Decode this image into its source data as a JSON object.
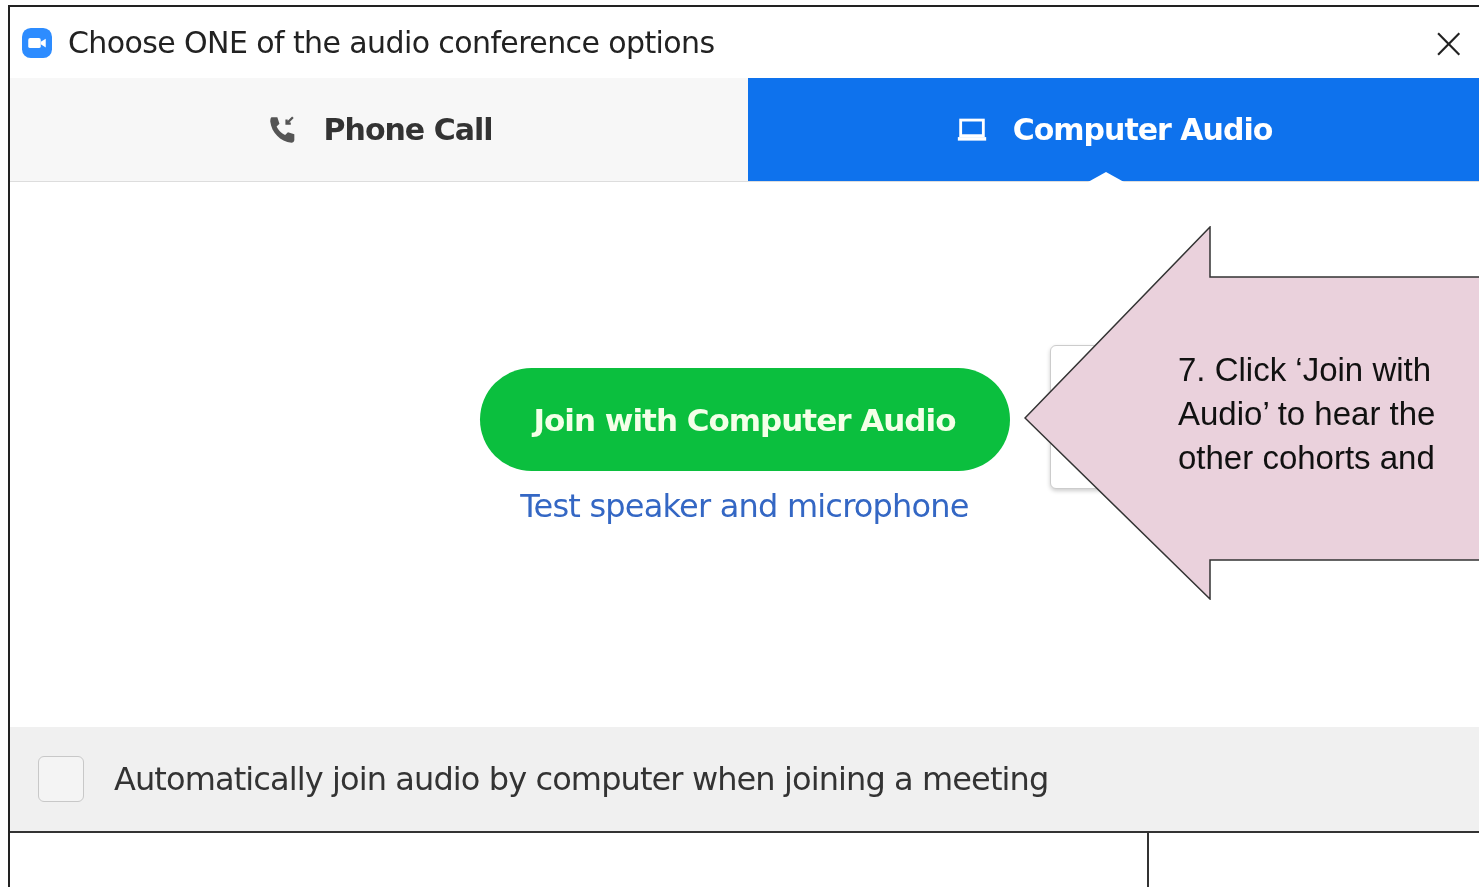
{
  "window": {
    "title": "Choose ONE of the audio conference options",
    "close": "×"
  },
  "tabs": [
    {
      "label": "Phone Call",
      "kind": "phone",
      "selected": false
    },
    {
      "label": "Computer Audio",
      "kind": "computer",
      "selected": true
    }
  ],
  "join_button": "Join with Computer Audio",
  "test_link": "Test speaker and microphone",
  "auto_join": {
    "label": "Automatically join audio by computer when joining a meeting",
    "checked": false
  },
  "callout": {
    "lines": [
      "7. Click ‘Join with",
      "Audio’ to hear the",
      "other cohorts and"
    ]
  }
}
